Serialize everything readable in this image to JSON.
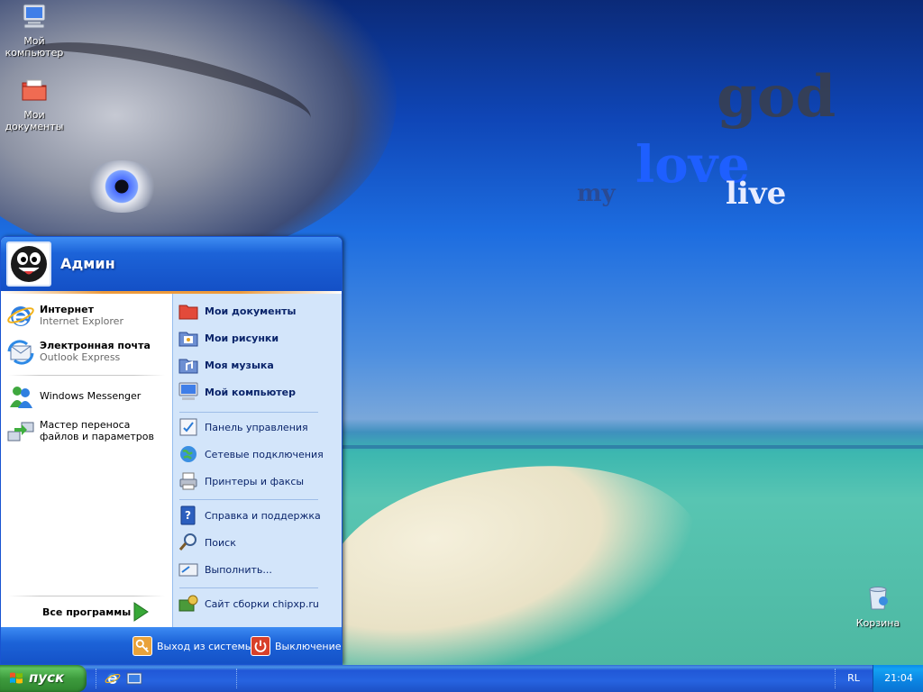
{
  "desktop": {
    "wallpaper_words": [
      "god",
      "love",
      "live",
      "my"
    ],
    "icons": {
      "my_computer": "Мой\nкомпьютер",
      "my_documents": "Мои\nдокументы",
      "recycle_bin": "Корзина"
    }
  },
  "start_menu": {
    "username": "Админ",
    "left_items": [
      {
        "title": "Интернет",
        "subtitle": "Internet Explorer"
      },
      {
        "title": "Электронная почта",
        "subtitle": "Outlook Express"
      },
      {
        "title": "Windows Messenger"
      },
      {
        "title": "Мастер переноса файлов и параметров"
      }
    ],
    "all_programs": "Все программы",
    "right_items": [
      {
        "label": "Мои документы"
      },
      {
        "label": "Мои рисунки"
      },
      {
        "label": "Моя музыка"
      },
      {
        "label": "Мой компьютер"
      },
      {
        "label": "Панель управления"
      },
      {
        "label": "Сетевые подключения"
      },
      {
        "label": "Принтеры и факсы"
      },
      {
        "label": "Справка и поддержка"
      },
      {
        "label": "Поиск"
      },
      {
        "label": "Выполнить..."
      },
      {
        "label": "Сайт сборки chipxp.ru"
      }
    ],
    "footer": {
      "logoff": "Выход из системы",
      "shutdown": "Выключение"
    }
  },
  "taskbar": {
    "start_label": "пуск",
    "language": "RL",
    "clock": "21:04"
  },
  "colors": {
    "taskbar_blue": "#2663e0",
    "start_green": "#3d9b3d",
    "menu_right_bg": "#d3e5fa",
    "tray_blue": "#0b84e2"
  }
}
